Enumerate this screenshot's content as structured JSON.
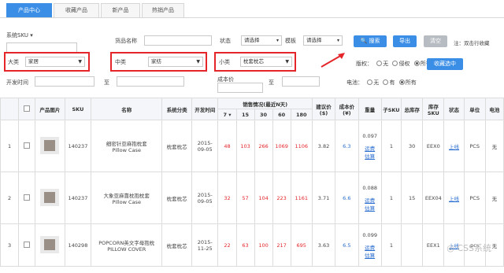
{
  "tabs": [
    "产品中心",
    "收藏产品",
    "新产品",
    "热销产品"
  ],
  "filters": {
    "system_sku_label": "系统SKU",
    "product_name_label": "货品名称",
    "status_label": "状态",
    "status_value": "请选择",
    "template_label": "模板",
    "template_value": "请选择",
    "search_button": "搜索",
    "export_button": "导出",
    "clear_button": "清空",
    "note": "注：双击行收藏",
    "major_label": "大类",
    "major_value": "家居",
    "middle_label": "中类",
    "middle_value": "家纺",
    "minor_label": "小类",
    "minor_value": "枕套枕芯",
    "plate_label": "版权：",
    "plate_opts": [
      "无",
      "侵权",
      "所有"
    ],
    "battery_label": "电池：",
    "battery_opts": [
      "无",
      "有",
      "所有"
    ],
    "collect_button": "收藏选中",
    "dev_time_label": "开发时间",
    "to1": "至",
    "cost_label": "成本价",
    "to2": "至"
  },
  "table": {
    "headers": {
      "image": "产品图片",
      "sku": "SKU",
      "name": "名称",
      "category": "系统分类",
      "dev_time": "开发时间",
      "sales_group": "销售情况(最近N天)",
      "d7": "7",
      "d15": "15",
      "d30": "30",
      "d60": "60",
      "d180": "180",
      "suggest_price": "建议价($)",
      "cost": "成本价(¥)",
      "weight": "重量",
      "sub_sku": "子SKU",
      "total_stock": "总库存",
      "stock_sku": "库存SKU",
      "status": "状态",
      "unit": "单位",
      "battery": "电池"
    },
    "rows": [
      {
        "idx": "1",
        "sku": "140237",
        "name": "细密针亚麻抱枕套",
        "name_en": "Pillow Case",
        "category": "枕套枕芯",
        "date1": "2015-",
        "date2": "09-05",
        "d7": "48",
        "d15": "103",
        "d30": "266",
        "d60": "1069",
        "d180": "1106",
        "price": "3.82",
        "cost": "6.3",
        "weight": "0.097",
        "calc1": "运费",
        "calc2": "估算",
        "sub": "1",
        "stock": "30",
        "stock_sku": "EEX0",
        "status": "上线",
        "unit": "PCS",
        "battery": "无"
      },
      {
        "idx": "2",
        "sku": "140237",
        "name": "大象亚麻靠枕抱枕套",
        "name_en": "Pillow Case",
        "category": "枕套枕芯",
        "date1": "2015-",
        "date2": "09-05",
        "d7": "32",
        "d15": "57",
        "d30": "104",
        "d60": "223",
        "d180": "1161",
        "price": "3.71",
        "cost": "6.6",
        "weight": "0.088",
        "calc1": "运费",
        "calc2": "估算",
        "sub": "1",
        "stock": "15",
        "stock_sku": "EEX04",
        "status": "上线",
        "unit": "PCS",
        "battery": "无"
      },
      {
        "idx": "3",
        "sku": "140298",
        "name": "POPCORN英文字母抱枕",
        "name_en": "PILLOW COVER",
        "category": "枕套枕芯",
        "date1": "2015-",
        "date2": "11-25",
        "d7": "22",
        "d15": "63",
        "d30": "100",
        "d60": "217",
        "d180": "695",
        "price": "3.63",
        "cost": "6.5",
        "weight": "0.099",
        "calc1": "运费",
        "calc2": "估算",
        "sub": "1",
        "stock": "",
        "stock_sku": "EEX1",
        "status": "上线",
        "unit": "pcs",
        "battery": "无"
      }
    ]
  },
  "watermark": "CSS系统"
}
